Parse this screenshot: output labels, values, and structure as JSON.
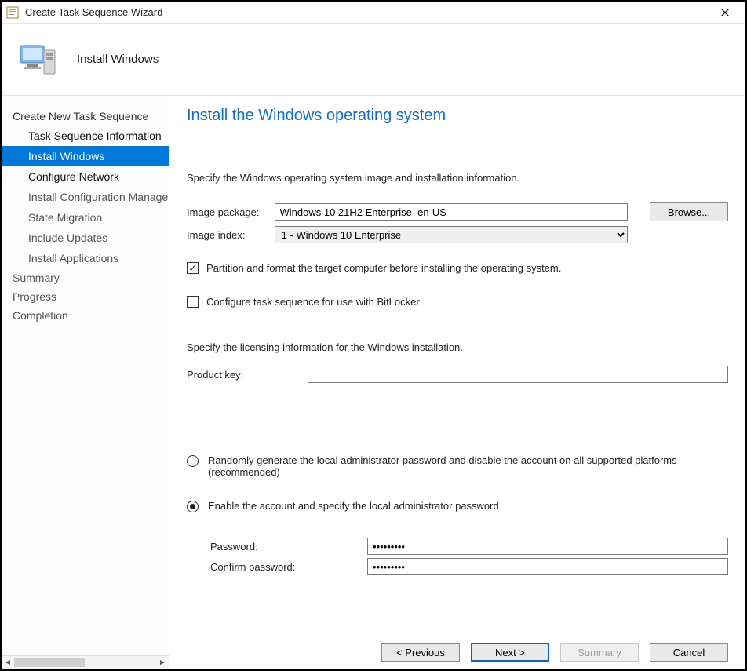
{
  "window": {
    "title": "Create Task Sequence Wizard"
  },
  "header": {
    "band_title": "Install Windows"
  },
  "sidebar": {
    "heading": "Create New Task Sequence",
    "items": [
      {
        "label": "Task Sequence Information",
        "style": "bold"
      },
      {
        "label": "Install Windows",
        "style": "selected"
      },
      {
        "label": "Configure Network",
        "style": "bold"
      },
      {
        "label": "Install Configuration Manager",
        "style": "dim"
      },
      {
        "label": "State Migration",
        "style": "dim"
      },
      {
        "label": "Include Updates",
        "style": "dim"
      },
      {
        "label": "Install Applications",
        "style": "dim"
      }
    ],
    "footer_items": [
      {
        "label": "Summary"
      },
      {
        "label": "Progress"
      },
      {
        "label": "Completion"
      }
    ]
  },
  "page": {
    "title": "Install the Windows operating system",
    "intro": "Specify the Windows operating system image and installation information.",
    "image_package_label": "Image package:",
    "image_package_value": "Windows 10 21H2 Enterprise  en-US",
    "browse_label": "Browse...",
    "image_index_label": "Image index:",
    "image_index_value": "1 - Windows 10 Enterprise",
    "partition_label": "Partition and format the target computer before installing the operating system.",
    "partition_checked": true,
    "bitlocker_label": "Configure task sequence for use with BitLocker",
    "bitlocker_checked": false,
    "licensing_text": "Specify the licensing information for the Windows installation.",
    "product_key_label": "Product key:",
    "product_key_value": "",
    "radio_random_label": "Randomly generate the local administrator password and disable the account on all supported platforms (recommended)",
    "radio_enable_label": "Enable the account and specify the local administrator password",
    "radio_selected": "enable",
    "password_label": "Password:",
    "password_value": "•••••••••",
    "confirm_label": "Confirm password:",
    "confirm_value": "•••••••••"
  },
  "footer": {
    "previous": "< Previous",
    "next": "Next >",
    "summary": "Summary",
    "cancel": "Cancel"
  }
}
